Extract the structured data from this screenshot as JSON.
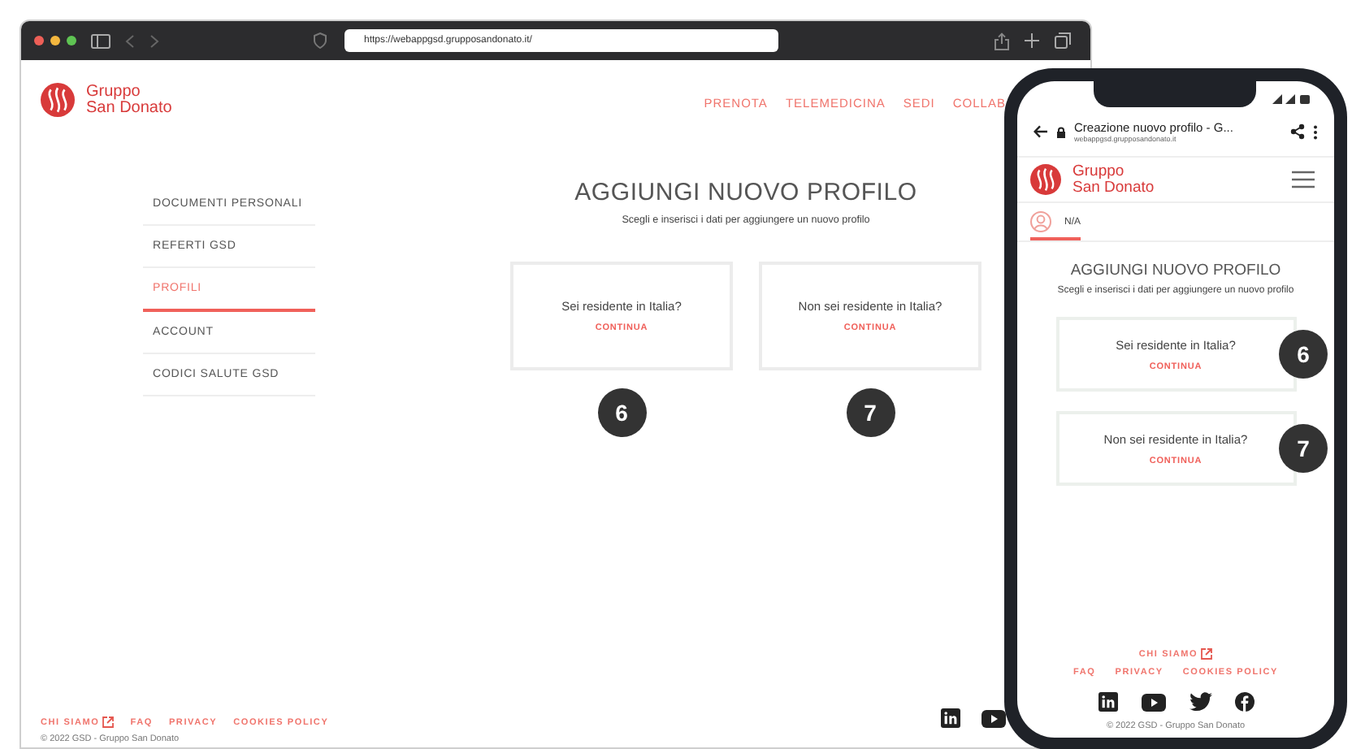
{
  "browser": {
    "url": "https://webappgsd.grupposandonato.it/"
  },
  "site": {
    "logo_line_1": "Gruppo",
    "logo_line_2": "San Donato",
    "nav": [
      {
        "label": "PRENOTA"
      },
      {
        "label": "TELEMEDICINA"
      },
      {
        "label": "SEDI"
      },
      {
        "label": "COLLAB"
      }
    ],
    "sidebar": [
      {
        "label": "DOCUMENTI PERSONALI",
        "selected": false
      },
      {
        "label": "REFERTI GSD",
        "selected": false
      },
      {
        "label": "PROFILI",
        "selected": true
      },
      {
        "label": "ACCOUNT",
        "selected": false
      },
      {
        "label": "CODICI SALUTE GSD",
        "selected": false
      }
    ],
    "title": "AGGIUNGI NUOVO PROFILO",
    "subtitle": "Scegli e inserisci i dati per aggiungere un nuovo profilo",
    "cards": [
      {
        "question": "Sei residente in Italia?",
        "action": "CONTINUA",
        "callout": "6"
      },
      {
        "question": "Non sei residente in Italia?",
        "action": "CONTINUA",
        "callout": "7"
      }
    ],
    "footer": {
      "links": [
        {
          "label": "CHI SIAMO",
          "external": true
        },
        {
          "label": "FAQ",
          "external": false
        },
        {
          "label": "PRIVACY",
          "external": false
        },
        {
          "label": "COOKIES POLICY",
          "external": false
        }
      ],
      "copyright": "© 2022 GSD - Gruppo San Donato"
    }
  },
  "phone": {
    "page_title": "Creazione nuovo profilo - G...",
    "url": "webappgsd.grupposandonato.it",
    "logo_line_1": "Gruppo",
    "logo_line_2": "San Donato",
    "profile_tabs": [
      {
        "label": "N/A",
        "selected": true
      }
    ],
    "title": "AGGIUNGI NUOVO PROFILO",
    "subtitle": "Scegli e inserisci i dati per aggiungere un nuovo profilo",
    "cards": [
      {
        "question": "Sei residente in Italia?",
        "action": "CONTINUA",
        "callout": "6"
      },
      {
        "question": "Non sei residente in Italia?",
        "action": "CONTINUA",
        "callout": "7"
      }
    ],
    "footer": {
      "link_rows": [
        [
          {
            "label": "CHI SIAMO",
            "external": true
          }
        ],
        [
          {
            "label": "FAQ",
            "external": false
          },
          {
            "label": "PRIVACY",
            "external": false
          },
          {
            "label": "COOKIES POLICY",
            "external": false
          }
        ]
      ],
      "copyright": "© 2022 GSD - Gruppo San Donato"
    }
  }
}
